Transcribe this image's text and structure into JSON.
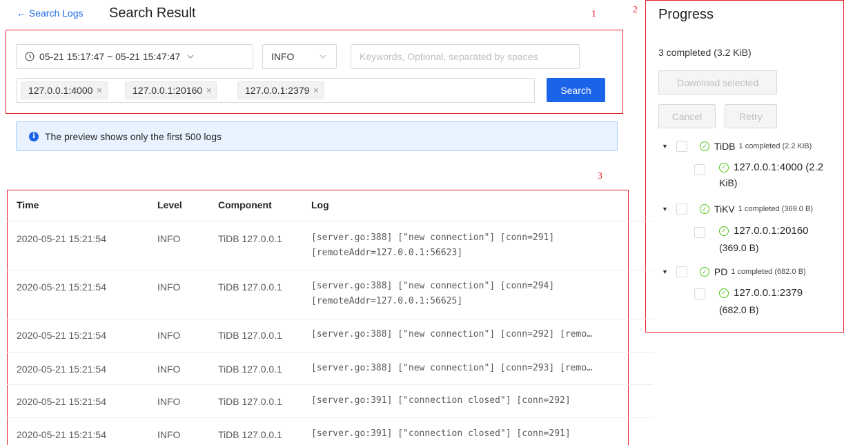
{
  "header": {
    "back_label": "← Search Logs",
    "title": "Search Result"
  },
  "annotations": {
    "one": "1",
    "two": "2",
    "three": "3"
  },
  "search": {
    "time_range": "05-21 15:17:47 ~ 05-21 15:47:47",
    "level": "INFO",
    "keywords_placeholder": "Keywords, Optional, separated by spaces",
    "instances": [
      "127.0.0.1:4000",
      "127.0.0.1:20160",
      "127.0.0.1:2379"
    ],
    "search_label": "Search"
  },
  "info": {
    "message": "The preview shows only the first 500 logs"
  },
  "table": {
    "headers": [
      "Time",
      "Level",
      "Component",
      "Log"
    ],
    "rows": [
      {
        "time": "2020-05-21 15:21:54",
        "level": "INFO",
        "component": "TiDB 127.0.0.1",
        "log1": "[server.go:388] [\"new connection\"] [conn=291]",
        "log2": "[remoteAddr=127.0.0.1:56623]"
      },
      {
        "time": "2020-05-21 15:21:54",
        "level": "INFO",
        "component": "TiDB 127.0.0.1",
        "log1": "[server.go:388] [\"new connection\"] [conn=294]",
        "log2": "[remoteAddr=127.0.0.1:56625]"
      },
      {
        "time": "2020-05-21 15:21:54",
        "level": "INFO",
        "component": "TiDB 127.0.0.1",
        "log1": "[server.go:388] [\"new connection\"] [conn=292] [remo…"
      },
      {
        "time": "2020-05-21 15:21:54",
        "level": "INFO",
        "component": "TiDB 127.0.0.1",
        "log1": "[server.go:388] [\"new connection\"] [conn=293] [remo…"
      },
      {
        "time": "2020-05-21 15:21:54",
        "level": "INFO",
        "component": "TiDB 127.0.0.1",
        "log1": "[server.go:391] [\"connection closed\"] [conn=292]"
      },
      {
        "time": "2020-05-21 15:21:54",
        "level": "INFO",
        "component": "TiDB 127.0.0.1",
        "log1": "[server.go:391] [\"connection closed\"] [conn=291]"
      }
    ]
  },
  "progress": {
    "title": "Progress",
    "summary": "3 completed (3.2 KiB)",
    "download_label": "Download selected",
    "cancel_label": "Cancel",
    "retry_label": "Retry",
    "groups": [
      {
        "name": "TiDB",
        "status": "1 completed (2.2 KiB)",
        "child_line1": "127.0.0.1:4000 (2.2",
        "child_line2": "KiB)"
      },
      {
        "name": "TiKV",
        "status": "1 completed (369.0 B)",
        "child_line1": "127.0.0.1:20160",
        "child_line2": "(369.0 B)"
      },
      {
        "name": "PD",
        "status": "1 completed (682.0 B)",
        "child_line1": "127.0.0.1:2379",
        "child_line2": "(682.0 B)"
      }
    ]
  },
  "colors": {
    "accent": "#1b63e8",
    "annotation": "#e8202a",
    "success": "#52c41a"
  },
  "icons": {
    "clock": "clock-icon",
    "chevron": "chevron-down-icon",
    "close": "close-icon",
    "info": "info-circle-icon",
    "check": "check-circle-icon",
    "caret": "caret-down-icon"
  }
}
